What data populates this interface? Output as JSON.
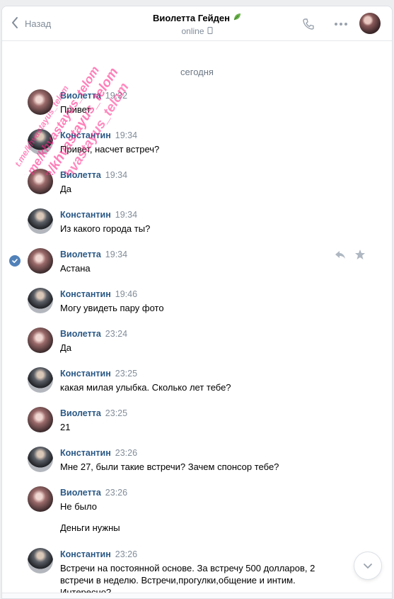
{
  "header": {
    "back_label": "Назад",
    "contact_name": "Виолетта Гейден",
    "status": "online",
    "icons": [
      "back-chevron-icon",
      "leaf-icon",
      "mobile-icon",
      "phone-icon",
      "more-icon",
      "avatar"
    ]
  },
  "date_separator": "сегодня",
  "watermark": {
    "lines": [
      "t.me/khvastayus_telom",
      "t.me/khvastayus_telom",
      "t.me/khvastayus_telom",
      "t.me/khvastayus_telom"
    ],
    "color": "#ff2a8a"
  },
  "messages": [
    {
      "author": "Виолетта",
      "time": "19:32",
      "text": "Привет"
    },
    {
      "author": "Константин",
      "time": "19:34",
      "text": "Привет, насчет встреч?"
    },
    {
      "author": "Виолетта",
      "time": "19:34",
      "text": "Да"
    },
    {
      "author": "Константин",
      "time": "19:34",
      "text": "Из какого города ты?"
    },
    {
      "author": "Виолетта",
      "time": "19:34",
      "text": "Астана"
    },
    {
      "author": "Константин",
      "time": "19:46",
      "text": "Могу увидеть пару фото"
    },
    {
      "author": "Виолетта",
      "time": "23:24",
      "text": "Да"
    },
    {
      "author": "Константин",
      "time": "23:25",
      "text": "какая милая улыбка. Сколько лет тебе?"
    },
    {
      "author": "Виолетта",
      "time": "23:25",
      "text": "21"
    },
    {
      "author": "Константин",
      "time": "23:26",
      "text": "Мне 27, были такие встречи? Зачем спонсор тебе?"
    },
    {
      "author": "Виолетта",
      "time": "23:26",
      "text": "Не было",
      "extra": "Деньги нужны"
    },
    {
      "author": "Константин",
      "time": "23:26",
      "text": "Встречи на постоянной основе. За встречу 500 долларов, 2 встречи в неделю. Встречи,прогулки,общение и интим. Интересно?"
    }
  ],
  "colors": {
    "link": "#2a5885",
    "muted": "#818c99",
    "accent": "#5181b8"
  }
}
